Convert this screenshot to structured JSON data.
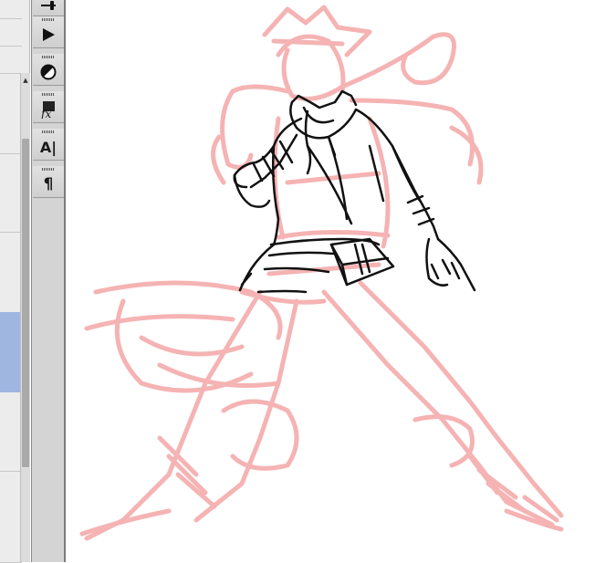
{
  "tools": [
    {
      "name": "slider-tool-icon"
    },
    {
      "name": "play-icon"
    },
    {
      "name": "half-circle-icon"
    },
    {
      "name": "fx-filter-icon",
      "label": "fx"
    },
    {
      "name": "text-tool-icon",
      "label": "A|"
    },
    {
      "name": "paragraph-icon",
      "label": "¶"
    }
  ],
  "colors": {
    "sketch_red": "#f4a6a6",
    "ink": "#111111",
    "selected_row": "#9fb6e0",
    "tool_bg": "#d4d4d4"
  },
  "left_panel": {
    "scroll_up_glyph": "▲"
  }
}
